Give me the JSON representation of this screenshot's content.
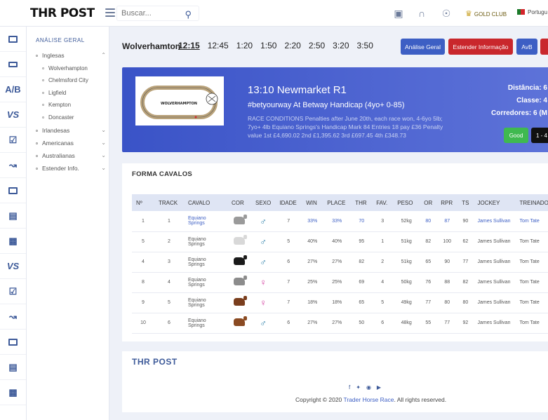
{
  "header": {
    "logo": "THR POST",
    "search_placeholder": "Buscar...",
    "gold_club": "GOLD CLUB",
    "language": "Portugu"
  },
  "rail_items": [
    "monitor-icon",
    "desktop-icon",
    "ab",
    "vs",
    "checklist-icon",
    "chart-icon",
    "monitor-icon",
    "server-icon",
    "ticket-icon",
    "vs",
    "checklist-icon",
    "chart-icon",
    "monitor-icon",
    "server-icon",
    "ticket-icon"
  ],
  "nav": {
    "heading": "ANÁLISE GERAL",
    "groups": {
      "inglesas": "Inglesas",
      "irlandesas": "Irlandesas",
      "americanas": "Americanas",
      "australianas": "Australianas",
      "estender": "Estender Info."
    },
    "inglesas_items": [
      "Wolverhampton",
      "Chelmsford City",
      "Ligfield",
      "Kempton",
      "Doncaster"
    ]
  },
  "race_bar": {
    "course": "Wolverhamton",
    "times": [
      "12:15",
      "12:45",
      "1:20",
      "1:50",
      "2:20",
      "2:50",
      "3:20",
      "3:50"
    ],
    "active_time": "12:15",
    "buttons": {
      "analise": "Análise Geral",
      "estender": "Estender Informação",
      "avb": "AvB"
    }
  },
  "race_card": {
    "track_label": "WOLVERHAMPTON",
    "title": "13:10 Newmarket R1",
    "subtitle": "#betyourway At Betway Handicap (4yo+ 0-85)",
    "description": "RACE CONDITIONS Penalties after June 20th, each race won, 4-6yo 5lb; 7yo+ 4lb Equiano Springs's Handicap Mark 84 Entries 18 pay £36 Penalty value 1st £4,690.02 2nd £1,395.62 3rd £697.45 4th £348.73",
    "distancia": "Distância: 6",
    "classe": "Classe: 4",
    "corredores": "Corredores: 6 (M",
    "going": "Good",
    "odds": "1 - 4"
  },
  "forma": {
    "title": "FORMA CAVALOS",
    "columns": [
      "Nº",
      "TRACK",
      "CAVALO",
      "COR",
      "SEXO",
      "IDADE",
      "WIN",
      "PLACE",
      "THR",
      "FAV.",
      "PESO",
      "OR",
      "RPR",
      "TS",
      "JOCKEY",
      "TREINADOR"
    ],
    "rows": [
      {
        "n": "1",
        "track": "1",
        "cavalo": "Equiano Springs",
        "cor": "#9a9a9a",
        "sexo": "♂",
        "sexo_class": "male",
        "idade": "7",
        "win": "33%",
        "place": "33%",
        "thr": "70",
        "fav": "3",
        "peso": "52kg",
        "or": "80",
        "rpr": "87",
        "ts": "90",
        "jockey": "James Sullivan",
        "treinador": "Tom Tate",
        "link": true
      },
      {
        "n": "5",
        "track": "2",
        "cavalo": "Equiano Springs",
        "cor": "#d8d8d8",
        "sexo": "♂",
        "sexo_class": "male",
        "idade": "5",
        "win": "40%",
        "place": "40%",
        "thr": "95",
        "fav": "1",
        "peso": "51kg",
        "or": "82",
        "rpr": "100",
        "ts": "62",
        "jockey": "James Sullivan",
        "treinador": "Tom Tate",
        "link": false
      },
      {
        "n": "4",
        "track": "3",
        "cavalo": "Equiano Springs",
        "cor": "#1a1a1a",
        "sexo": "♂",
        "sexo_class": "male",
        "idade": "6",
        "win": "27%",
        "place": "27%",
        "thr": "82",
        "fav": "2",
        "peso": "51kg",
        "or": "65",
        "rpr": "90",
        "ts": "77",
        "jockey": "James Sullivan",
        "treinador": "Tom Tate",
        "link": false
      },
      {
        "n": "8",
        "track": "4",
        "cavalo": "Equiano Springs",
        "cor": "#8c8c8c",
        "sexo": "♀",
        "sexo_class": "female",
        "idade": "7",
        "win": "25%",
        "place": "25%",
        "thr": "69",
        "fav": "4",
        "peso": "50kg",
        "or": "76",
        "rpr": "88",
        "ts": "82",
        "jockey": "James Sullivan",
        "treinador": "Tom Tate",
        "link": false
      },
      {
        "n": "9",
        "track": "5",
        "cavalo": "Equiano Springs",
        "cor": "#7a3e1d",
        "sexo": "♀",
        "sexo_class": "female",
        "idade": "7",
        "win": "18%",
        "place": "18%",
        "thr": "65",
        "fav": "5",
        "peso": "49kg",
        "or": "77",
        "rpr": "80",
        "ts": "80",
        "jockey": "James Sullivan",
        "treinador": "Tom Tate",
        "link": false
      },
      {
        "n": "10",
        "track": "6",
        "cavalo": "Equiano Springs",
        "cor": "#8a4a22",
        "sexo": "♂",
        "sexo_class": "male",
        "idade": "6",
        "win": "27%",
        "place": "27%",
        "thr": "50",
        "fav": "6",
        "peso": "48kg",
        "or": "55",
        "rpr": "77",
        "ts": "92",
        "jockey": "James Sullivan",
        "treinador": "Tom Tate",
        "link": false
      }
    ]
  },
  "footer": {
    "logo": "THR POST",
    "copy_prefix": "Copyright © 2020",
    "copy_link": "Trader Horse Race",
    "copy_suffix": ". All rights reserved."
  }
}
